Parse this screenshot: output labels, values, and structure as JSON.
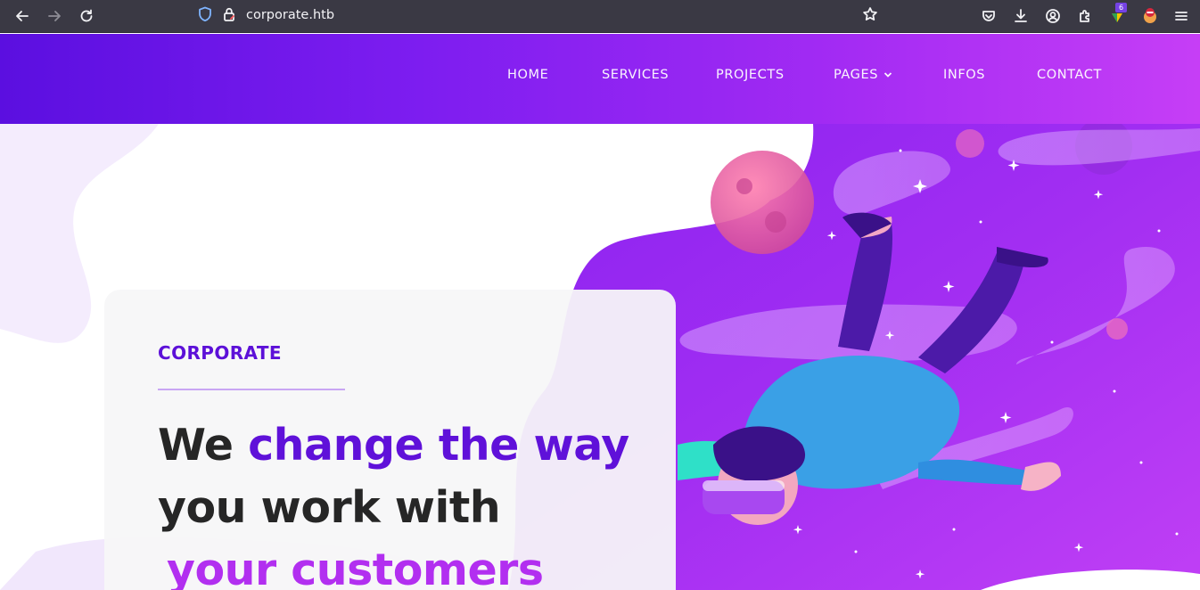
{
  "browser": {
    "url": "corporate.htb",
    "extension_badge": "6",
    "icons": [
      "back-icon",
      "forward-icon",
      "reload-icon",
      "shield-icon",
      "lock-icon",
      "star-icon",
      "pocket-icon",
      "download-icon",
      "account-icon",
      "extensions-icon",
      "extension-icon",
      "addon-icon",
      "menu-icon"
    ]
  },
  "nav": {
    "items": [
      {
        "label": "HOME"
      },
      {
        "label": "SERVICES"
      },
      {
        "label": "PROJECTS"
      },
      {
        "label": "PAGES"
      },
      {
        "label": "INFOS"
      },
      {
        "label": "CONTACT"
      }
    ]
  },
  "hero": {
    "tag": "CORPORATE",
    "headline": {
      "part1": "We ",
      "part2": "change the way",
      "line2": "you work with",
      "line3": "your customers"
    }
  },
  "colors": {
    "nav_start": "#5b0fe0",
    "nav_end": "#c63ef6",
    "accent_purple": "#5f11d9",
    "accent_pink": "#b22ff0",
    "chrome_bg": "#3a3944"
  }
}
